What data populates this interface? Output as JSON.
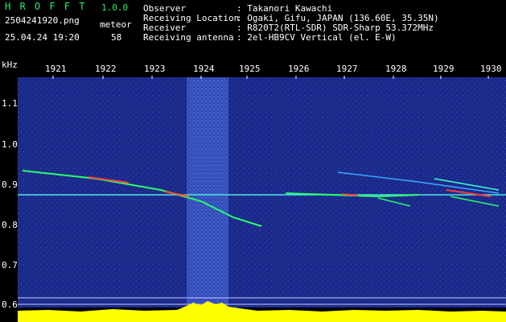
{
  "header": {
    "app_name": "H R O F F T",
    "version": "1.0.0",
    "filename": "2504241920.png",
    "datetime": "25.04.24 19:20",
    "meteor_label": "meteor",
    "meteor_count": "58",
    "fields": [
      {
        "label": "Observer",
        "value": ": Takanori Kawachi"
      },
      {
        "label": "Receiving Location",
        "value": ": Ogaki, Gifu, JAPAN (136.60E, 35.35N)"
      },
      {
        "label": "Receiver",
        "value": ": R820T2(RTL-SDR) SDR-Sharp 53.372MHz"
      },
      {
        "label": "Receiving antenna",
        "value": ": 2el-HB9CV Vertical (el. E-W)"
      }
    ]
  },
  "spectrogram": {
    "y_unit": "kHz",
    "time_labels": [
      "1921",
      "1922",
      "1923",
      "1924",
      "1925",
      "1926",
      "1927",
      "1928",
      "1929",
      "1930"
    ],
    "freq_labels": [
      "1.1",
      "1.0",
      "0.9",
      "0.8",
      "0.7",
      "0.6"
    ],
    "colors": {
      "background": "#1a2a8c",
      "carrier": "#4fe8e0",
      "trail": "#2aff6a",
      "burst": "#ff3a3a",
      "level": "#ffff00"
    }
  }
}
